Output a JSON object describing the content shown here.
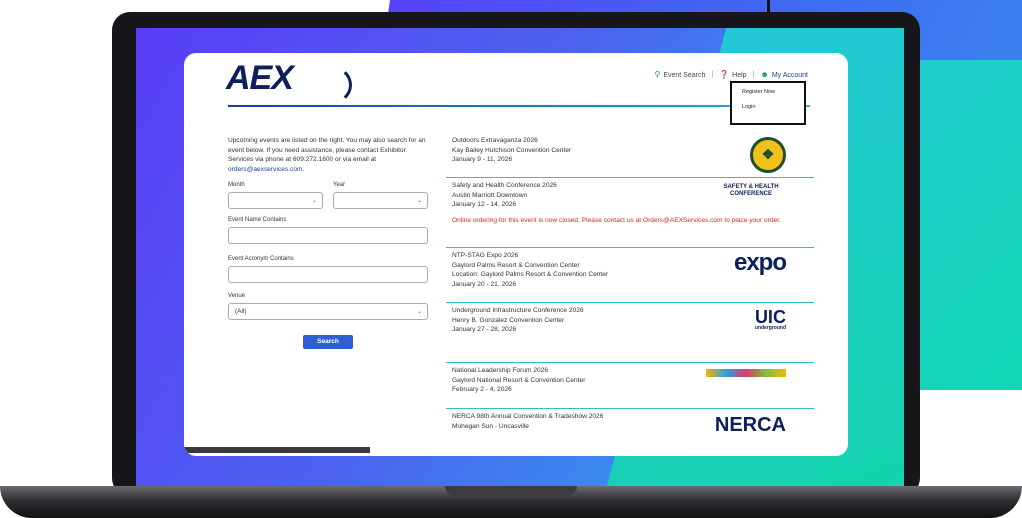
{
  "site": {
    "logo": "AEX",
    "nav": {
      "event_search": "Event Search",
      "help": "Help",
      "my_account": "My Account",
      "search_icon": "search-icon",
      "help_icon": "help-icon",
      "user_icon": "user-icon"
    },
    "account_menu": {
      "register": "Register Now",
      "login": "Login"
    },
    "intro_text": "Upcoming events are listed on the right. You may also search for an event below. If you need assistance, please contact Exhibitor Services via phone at 609.272.1600 or via email at",
    "intro_email": "orders@aexservices.com",
    "intro_end": ".",
    "form": {
      "month_label": "Month",
      "year_label": "Year",
      "name_label": "Event Name Contains",
      "acronym_label": "Event Acronym Contains",
      "venue_label": "Venue",
      "venue_value": "(All)",
      "search_button": "Search"
    },
    "events": [
      {
        "name": "Outdoors Extravaganza 2026",
        "venue": "Kay Bailey Hutchison Convention Center",
        "dates": "January 9 - 11, 2026"
      },
      {
        "name": "Safety and Health Conference 2026",
        "venue": "Austin Marriott Downtown",
        "dates": "January 12 - 14, 2026",
        "warning": "Online ordering for this event is now closed. Please contact us at Orders@AEXServices.com to place your order.",
        "logo_text": "SAFETY & HEALTH CONFERENCE"
      },
      {
        "name": "NTP-STAG Expo 2026",
        "venue": "Gaylord Palms Resort & Convention Center",
        "location": "Location: Gaylord Palms Resort & Convention Center",
        "dates": "January 20 - 21, 2026",
        "logo_text": "expo"
      },
      {
        "name": "Underground Infrastructure Conference 2026",
        "venue": "Henry B. Gonzalez Convention Center",
        "dates": "January 27 - 28, 2026",
        "logo_text": "UIC",
        "logo_sub": "underground"
      },
      {
        "name": "National Leadership Forum 2026",
        "venue": "Gaylord National Resort & Convention Center",
        "dates": "February 2 - 4, 2026"
      },
      {
        "name": "NERCA 98th Annual Convention & Tradeshow 2026",
        "venue": "Mohegan Sun - Uncasville",
        "logo_text": "NERCA"
      }
    ]
  }
}
